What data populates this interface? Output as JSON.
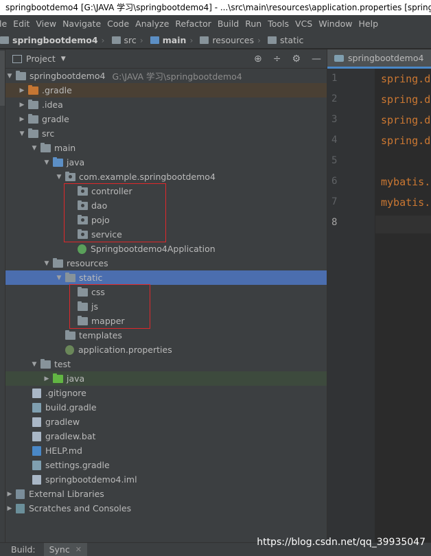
{
  "window": {
    "title": "springbootdemo4 [G:\\JAVA 学习\\springbootdemo4] - ...\\src\\main\\resources\\application.properties [spring"
  },
  "menu": [
    "le",
    "Edit",
    "View",
    "Navigate",
    "Code",
    "Analyze",
    "Refactor",
    "Build",
    "Run",
    "Tools",
    "VCS",
    "Window",
    "Help"
  ],
  "breadcrumb": {
    "items": [
      "springbootdemo4",
      "src",
      "main",
      "resources",
      "static"
    ]
  },
  "project_panel": {
    "title": "Project",
    "tools": [
      "⊕",
      "÷",
      "⚙",
      "—"
    ]
  },
  "tree": [
    {
      "label": "springbootdemo4",
      "path": "G:\\JAVA 学习\\springbootdemo4"
    },
    {
      "label": ".gradle"
    },
    {
      "label": ".idea"
    },
    {
      "label": "gradle"
    },
    {
      "label": "src"
    },
    {
      "label": "main"
    },
    {
      "label": "java"
    },
    {
      "label": "com.example.springbootdemo4"
    },
    {
      "label": "controller"
    },
    {
      "label": "dao"
    },
    {
      "label": "pojo"
    },
    {
      "label": "service"
    },
    {
      "label": "Springbootdemo4Application"
    },
    {
      "label": "resources"
    },
    {
      "label": "static"
    },
    {
      "label": "css"
    },
    {
      "label": "js"
    },
    {
      "label": "mapper"
    },
    {
      "label": "templates"
    },
    {
      "label": "application.properties"
    },
    {
      "label": "test"
    },
    {
      "label": "java"
    },
    {
      "label": ".gitignore"
    },
    {
      "label": "build.gradle"
    },
    {
      "label": "gradlew"
    },
    {
      "label": "gradlew.bat"
    },
    {
      "label": "HELP.md"
    },
    {
      "label": "settings.gradle"
    },
    {
      "label": "springbootdemo4.iml"
    },
    {
      "label": "External Libraries"
    },
    {
      "label": "Scratches and Consoles"
    }
  ],
  "editor": {
    "tab_label": "springbootdemo4",
    "line_numbers": [
      "1",
      "2",
      "3",
      "4",
      "5",
      "6",
      "7",
      "8"
    ],
    "lines": [
      "spring.d",
      "spring.d",
      "spring.d",
      "spring.d",
      "",
      "mybatis.",
      "mybatis.",
      ""
    ]
  },
  "bottom": {
    "build_label": "Build:",
    "sync_label": "Sync",
    "close": "✕"
  },
  "watermark": "https://blog.csdn.net/qq_39935047",
  "colors": {
    "selection": "#4b6eaf",
    "annotation_box": "#e0282b",
    "keyword": "#cc7832"
  }
}
